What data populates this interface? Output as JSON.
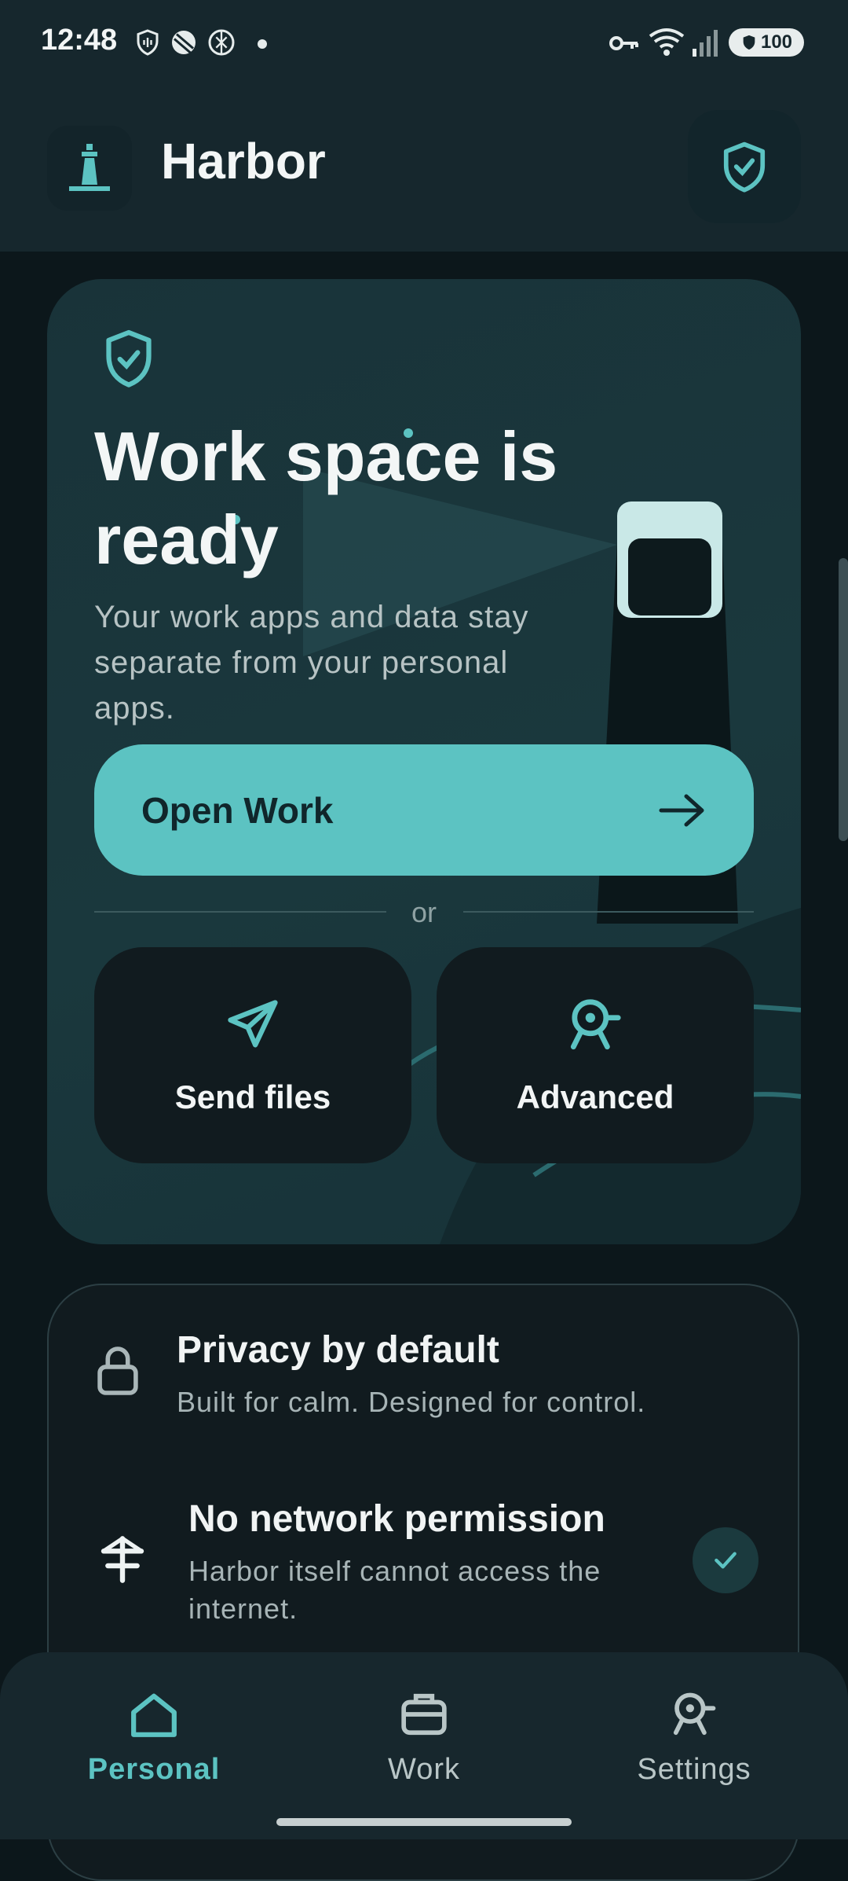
{
  "status_bar": {
    "time": "12:48",
    "battery": "100"
  },
  "header": {
    "title": "Harbor"
  },
  "hero": {
    "title": "Work space is ready",
    "subtitle": "Your work apps and data stay separate from your personal apps.",
    "primary_button": "Open Work",
    "divider_label": "or",
    "tiles": [
      {
        "label": "Send files",
        "icon": "send-icon"
      },
      {
        "label": "Advanced",
        "icon": "advanced-icon"
      }
    ]
  },
  "privacy": {
    "items": [
      {
        "title": "Privacy by default",
        "description": "Built for calm. Designed for control.",
        "icon": "lock-icon"
      },
      {
        "title": "No network permission",
        "description": "Harbor itself cannot access the internet.",
        "icon": "no-network-icon",
        "checked": true
      }
    ]
  },
  "bottom_nav": {
    "items": [
      {
        "label": "Personal",
        "icon": "home-icon",
        "active": true
      },
      {
        "label": "Work",
        "icon": "briefcase-icon",
        "active": false
      },
      {
        "label": "Settings",
        "icon": "settings-icon",
        "active": false
      }
    ]
  },
  "colors": {
    "accent": "#5cc3c2",
    "background": "#0c171b",
    "card": "#1a383d"
  }
}
